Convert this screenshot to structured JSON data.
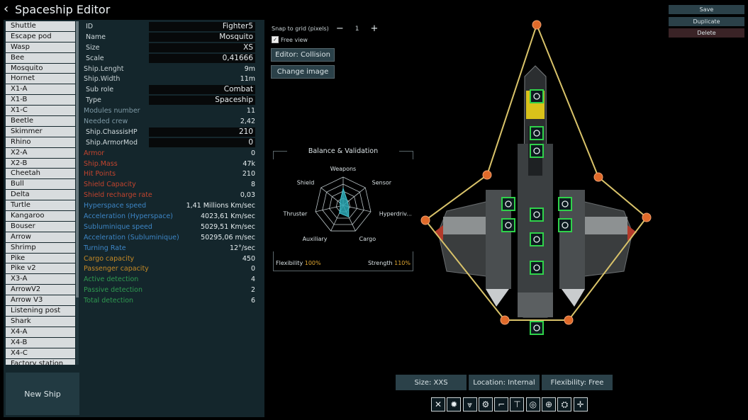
{
  "header": {
    "title": "Spaceship Editor"
  },
  "ship_list": [
    "Shuttle",
    "Escape pod",
    "Wasp",
    "Bee",
    "Mosquito",
    "Hornet",
    "X1-A",
    "X1-B",
    "X1-C",
    "Beetle",
    "Skimmer",
    "Rhino",
    "X2-A",
    "X2-B",
    "Cheetah",
    "Bull",
    "Delta",
    "Turtle",
    "Kangaroo",
    "Bouser",
    "Arrow",
    "Shrimp",
    "Pike",
    "Pike v2",
    "X3-A",
    "ArrowV2",
    "Arrow V3",
    "Listening post",
    "Shark",
    "X4-A",
    "X4-B",
    "X4-C",
    "Factory station"
  ],
  "new_ship_label": "New Ship",
  "fields": {
    "id": {
      "label": "ID",
      "value": "Fighter5"
    },
    "name": {
      "label": "Name",
      "value": "Mosquito"
    },
    "size": {
      "label": "Size",
      "value": "XS"
    },
    "scale": {
      "label": "Scale",
      "value": "0,41666"
    },
    "sub_role": {
      "label": "Sub role",
      "value": "Combat"
    },
    "type": {
      "label": "Type",
      "value": "Spaceship"
    },
    "chassis_hp": {
      "label": "Ship.ChassisHP",
      "value": "210"
    },
    "armor_mod": {
      "label": "Ship.ArmorMod",
      "value": "0"
    }
  },
  "stats": {
    "length": {
      "label": "Ship.Lenght",
      "value": "9m"
    },
    "width": {
      "label": "Ship.Width",
      "value": "11m"
    },
    "modules_number": {
      "label": "Modules number",
      "value": "11"
    },
    "needed_crew": {
      "label": "Needed crew",
      "value": "2,42"
    },
    "armor": {
      "label": "Armor",
      "value": "0"
    },
    "ship_mass": {
      "label": "Ship.Mass",
      "value": "47k"
    },
    "hit_points": {
      "label": "Hit Points",
      "value": "210"
    },
    "shield_capacity": {
      "label": "Shield Capacity",
      "value": "8"
    },
    "shield_recharge": {
      "label": "Shield recharge rate",
      "value": "0,03"
    },
    "hyperspace_speed": {
      "label": "Hyperspace speed",
      "value": "1,41 Millions Km/sec"
    },
    "accel_hyper": {
      "label": "Acceleration (Hyperspace)",
      "value": "4023,61 Km/sec"
    },
    "subluminique_speed": {
      "label": "Subluminique speed",
      "value": "5029,51 Km/sec"
    },
    "accel_sub": {
      "label": "Acceleration (Subluminique)",
      "value": "50295,06 m/sec"
    },
    "turning_rate": {
      "label": "Turning Rate",
      "value": "12°/sec"
    },
    "cargo_capacity": {
      "label": "Cargo capacity",
      "value": "450"
    },
    "passenger_capacity": {
      "label": "Passenger capacity",
      "value": "0"
    },
    "active_detection": {
      "label": "Active detection",
      "value": "4"
    },
    "passive_detection": {
      "label": "Passive detection",
      "value": "2"
    },
    "total_detection": {
      "label": "Total detection",
      "value": "6"
    }
  },
  "editor": {
    "snap_label": "Snap to grid (pixels)",
    "snap_value": "1",
    "minus": "−",
    "plus": "+",
    "free_view_label": "Free view",
    "free_view_checked": true,
    "mode_button": "Editor:  Collision",
    "change_image_button": "Change image"
  },
  "balance": {
    "title": "Balance & Validation",
    "axes": [
      "Weapons",
      "Sensor",
      "Hyperdriv...",
      "Cargo",
      "Auxiliary",
      "Thruster",
      "Shield"
    ],
    "values": [
      0.6,
      0.2,
      0.2,
      0.45,
      0.3,
      0.1,
      0.15
    ],
    "flexibility_label": "Flexibility",
    "flexibility_value": "100%",
    "strength_label": "Strength",
    "strength_value": "110%",
    "fill_color": "#2aa7b4"
  },
  "actions": {
    "save": "Save",
    "duplicate": "Duplicate",
    "delete": "Delete"
  },
  "module_info": {
    "size": "Size:  XXS",
    "location": "Location:  Internal",
    "flexibility": "Flexibility:  Free"
  },
  "module_icons": [
    "cross-weapons-icon",
    "splash-icon",
    "shield-chevrons-icon",
    "gear-icon",
    "gun-icon",
    "turret-icon",
    "radar-icon",
    "steering-icon",
    "life-support-icon",
    "targeting-icon"
  ],
  "colors": {
    "panel": "#14262c",
    "accent": "#2aa7b4",
    "collision_line": "#d9c36a",
    "collision_node": "#e06a2a"
  }
}
